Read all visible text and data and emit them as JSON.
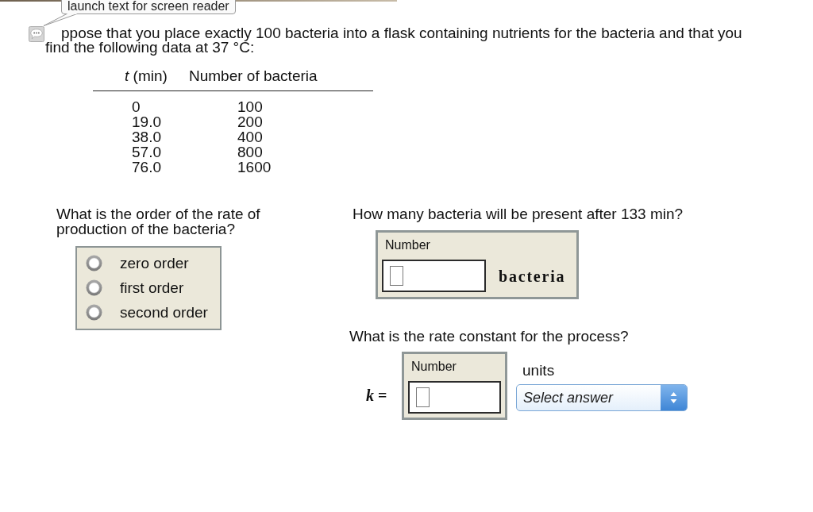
{
  "tooltip": {
    "text": "launch text for screen reader"
  },
  "problem": {
    "text": "ppose that you place exactly 100 bacteria into a flask containing nutrients for the bacteria and that you find the following data at 37 °C:"
  },
  "data_table": {
    "columns": [
      "*t* (min)",
      "Number of bacteria"
    ],
    "rows": [
      [
        "0",
        "100"
      ],
      [
        "19.0",
        "200"
      ],
      [
        "38.0",
        "400"
      ],
      [
        "57.0",
        "800"
      ],
      [
        "76.0",
        "1600"
      ]
    ]
  },
  "questions": [
    {
      "kind": "choice",
      "prompt": "What is the order of the rate of production of the bacteria?",
      "options": [
        {
          "label": "zero order",
          "selected": false
        },
        {
          "label": "first order",
          "selected": false
        },
        {
          "label": "second order",
          "selected": false
        }
      ]
    },
    {
      "kind": "number",
      "prompt": "How many bacteria will be present after 133 min?",
      "field_label": "Number",
      "unit": "bacteria"
    },
    {
      "kind": "number_units",
      "prompt": "What is the rate constant for the process?",
      "variable": "*k* =",
      "field_label": "Number",
      "units_label": "units",
      "units_select": {
        "placeholder": "Select answer"
      }
    }
  ]
}
